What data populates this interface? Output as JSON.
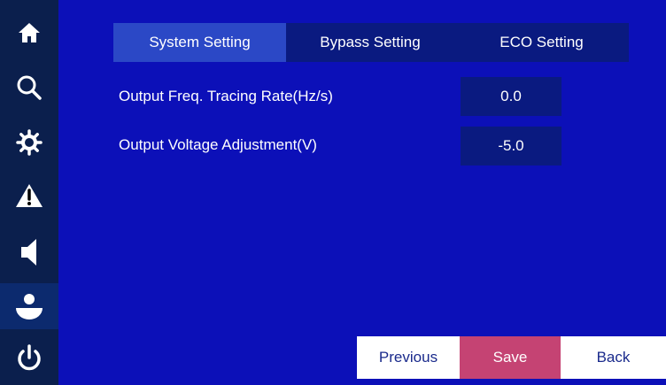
{
  "sidebar": {
    "icons": [
      "home-icon",
      "search-icon",
      "gear-icon",
      "warning-icon",
      "speaker-icon",
      "user-icon",
      "power-icon"
    ],
    "active_index": 5
  },
  "tabs": [
    {
      "label": "System Setting",
      "active": true
    },
    {
      "label": "Bypass Setting",
      "active": false
    },
    {
      "label": "ECO Setting",
      "active": false
    }
  ],
  "settings": [
    {
      "label": "Output Freq. Tracing Rate(Hz/s)",
      "value": "0.0"
    },
    {
      "label": "Output Voltage Adjustment(V)",
      "value": "-5.0"
    }
  ],
  "buttons": {
    "previous": "Previous",
    "save": "Save",
    "back": "Back"
  },
  "colors": {
    "background": "#0c10b8",
    "sidebar": "#0b1f4d",
    "tab_active": "#2b48c6",
    "value_box": "#0a1a80",
    "save_button": "#c54373"
  }
}
